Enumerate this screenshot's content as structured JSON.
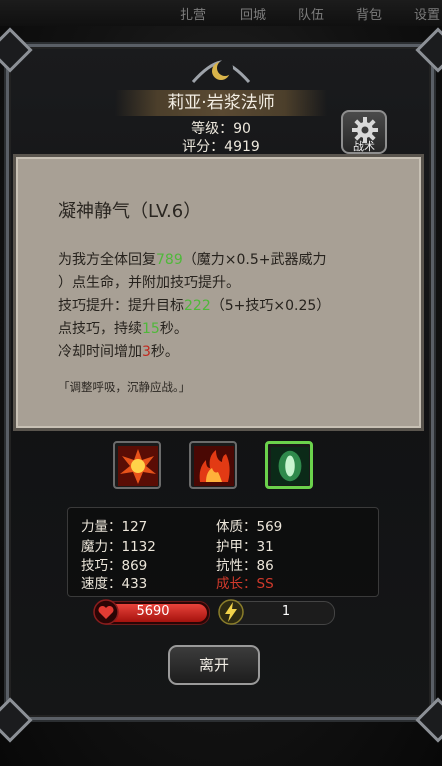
{
  "topnav": [
    "扎营",
    "回城",
    "队伍",
    "背包",
    "设置"
  ],
  "character": {
    "name": "莉亚·岩浆法师",
    "level_line": "等级：90",
    "score_line": "评分：4919"
  },
  "tactics_button": {
    "label": "战术",
    "icon": "gear-icon"
  },
  "tooltip": {
    "title": "凝神静气（LV.6）",
    "line1_a": "为我方全体回复",
    "line1_num": "789",
    "line1_b": "（魔力×0.5+武器威力",
    "line2": "）点生命，并附加技巧提升。",
    "line3_a": "技巧提升：提升目标",
    "line3_num": "222",
    "line3_b": "（5+技巧×0.25）",
    "line4_a": "点技巧，持续",
    "line4_num": "15",
    "line4_b": "秒。",
    "line5_a": "冷却时间增加",
    "line5_num": "3",
    "line5_b": "秒。",
    "quote": "「调整呼吸，沉静应战。」",
    "colors": {
      "heal_value": "#4fb83a",
      "cooldown_value": "#c0291e"
    }
  },
  "skills": [
    {
      "icon": "fire-burst-icon",
      "selected": false
    },
    {
      "icon": "flame-icon",
      "selected": false
    },
    {
      "icon": "green-light-icon",
      "selected": true
    }
  ],
  "stats": {
    "strength": "力量：127",
    "magic": "魔力：1132",
    "technique": "技巧：869",
    "speed": "速度：433",
    "constitution": "体质：569",
    "armor": "护甲：31",
    "resistance": "抗性：86",
    "growth": "成长：SS"
  },
  "hp": {
    "value": "5690",
    "icon": "heart-icon",
    "fill": 1.0
  },
  "energy": {
    "value": "1",
    "icon": "lightning-icon"
  },
  "leave_button": "离开"
}
